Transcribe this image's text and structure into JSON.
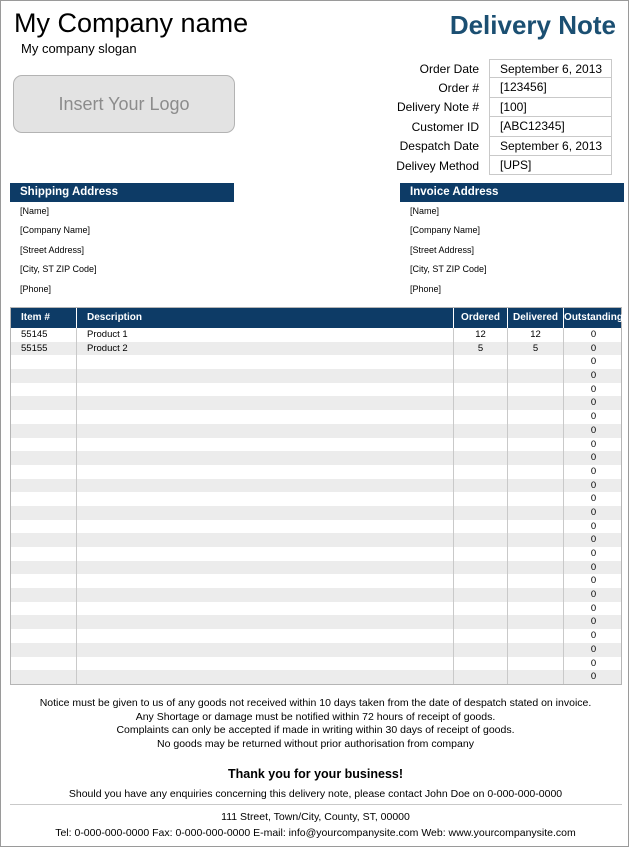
{
  "header": {
    "company_name": "My Company name",
    "company_slogan": "My company slogan",
    "doc_title": "Delivery Note",
    "logo_placeholder": "Insert Your Logo"
  },
  "meta": [
    {
      "label": "Order Date",
      "value": "September 6, 2013"
    },
    {
      "label": "Order #",
      "value": "[123456]"
    },
    {
      "label": "Delivery Note #",
      "value": "[100]"
    },
    {
      "label": "Customer ID",
      "value": "[ABC12345]"
    },
    {
      "label": "Despatch Date",
      "value": "September 6, 2013"
    },
    {
      "label": "Delivey Method",
      "value": "[UPS]"
    }
  ],
  "shipping": {
    "title": "Shipping Address",
    "lines": [
      "[Name]",
      "[Company Name]",
      "[Street Address]",
      "[City, ST  ZIP Code]",
      "[Phone]"
    ]
  },
  "invoice": {
    "title": "Invoice Address",
    "lines": [
      "[Name]",
      "[Company Name]",
      "[Street Address]",
      "[City, ST  ZIP Code]",
      "[Phone]"
    ]
  },
  "items": {
    "columns": [
      "Item #",
      "Description",
      "Ordered",
      "Delivered",
      "Outstanding"
    ],
    "rows": [
      [
        "55145",
        "Product 1",
        "12",
        "12",
        "0"
      ],
      [
        "55155",
        "Product 2",
        "5",
        "5",
        "0"
      ],
      [
        "",
        "",
        "",
        "",
        "0"
      ],
      [
        "",
        "",
        "",
        "",
        "0"
      ],
      [
        "",
        "",
        "",
        "",
        "0"
      ],
      [
        "",
        "",
        "",
        "",
        "0"
      ],
      [
        "",
        "",
        "",
        "",
        "0"
      ],
      [
        "",
        "",
        "",
        "",
        "0"
      ],
      [
        "",
        "",
        "",
        "",
        "0"
      ],
      [
        "",
        "",
        "",
        "",
        "0"
      ],
      [
        "",
        "",
        "",
        "",
        "0"
      ],
      [
        "",
        "",
        "",
        "",
        "0"
      ],
      [
        "",
        "",
        "",
        "",
        "0"
      ],
      [
        "",
        "",
        "",
        "",
        "0"
      ],
      [
        "",
        "",
        "",
        "",
        "0"
      ],
      [
        "",
        "",
        "",
        "",
        "0"
      ],
      [
        "",
        "",
        "",
        "",
        "0"
      ],
      [
        "",
        "",
        "",
        "",
        "0"
      ],
      [
        "",
        "",
        "",
        "",
        "0"
      ],
      [
        "",
        "",
        "",
        "",
        "0"
      ],
      [
        "",
        "",
        "",
        "",
        "0"
      ],
      [
        "",
        "",
        "",
        "",
        "0"
      ],
      [
        "",
        "",
        "",
        "",
        "0"
      ],
      [
        "",
        "",
        "",
        "",
        "0"
      ],
      [
        "",
        "",
        "",
        "",
        "0"
      ],
      [
        "",
        "",
        "",
        "",
        "0"
      ]
    ]
  },
  "footer": {
    "notice": [
      "Notice must be given to us of any goods not received within 10 days taken from the date of despatch stated on invoice.",
      "Any Shortage or damage must be notified within 72 hours of receipt of goods.",
      "Complaints can only be accepted if made in writing within 30 days of receipt of goods.",
      "No goods may be returned without prior authorisation from company"
    ],
    "thanks": "Thank you for your business!",
    "enquiry": "Should you have any enquiries concerning this delivery note, please contact John Doe on 0-000-000-0000",
    "address": "111 Street, Town/City, County, ST, 00000",
    "contact": "Tel: 0-000-000-0000 Fax: 0-000-000-0000 E-mail: info@yourcompanysite.com Web: www.yourcompanysite.com"
  },
  "colors": {
    "title_blue": "#1b4f72",
    "header_navy": "#0d3b66",
    "stripe_gray": "#ececec"
  }
}
